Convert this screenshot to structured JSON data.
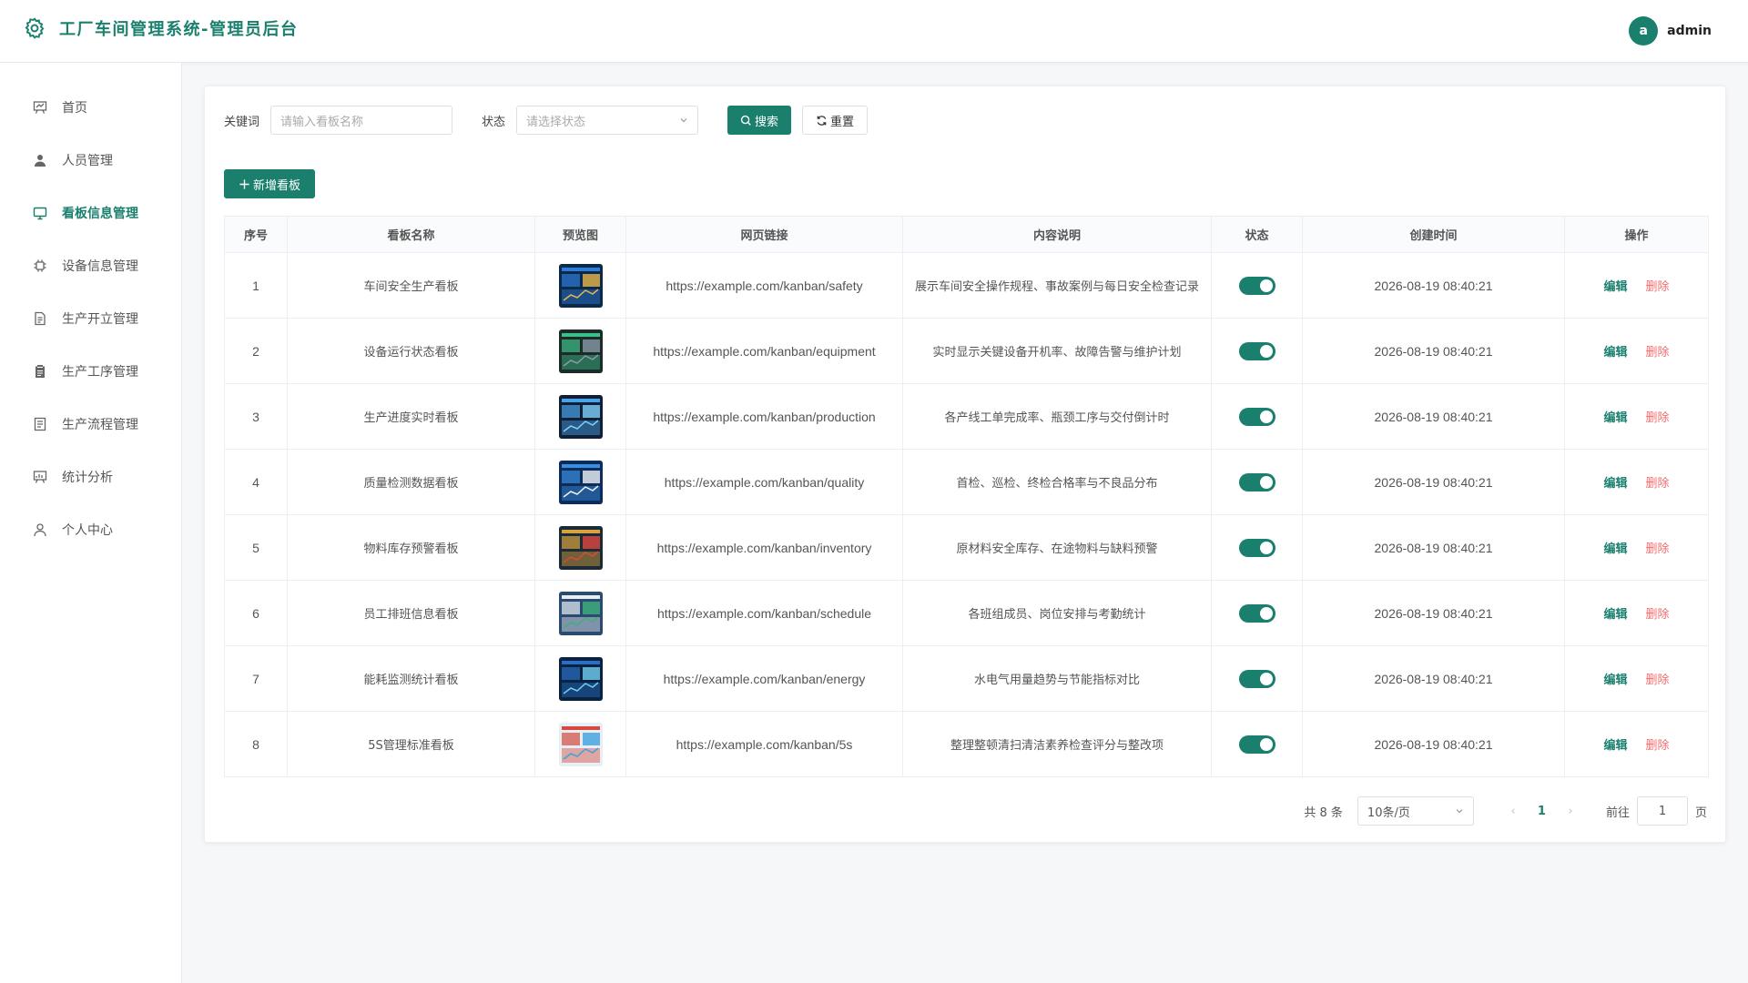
{
  "app": {
    "title": "工厂车间管理系统-管理员后台"
  },
  "user": {
    "avatar_letter": "a",
    "name": "admin"
  },
  "sidebar": {
    "items": [
      {
        "label": "首页",
        "icon": "presentation-board-icon",
        "active": false
      },
      {
        "label": "人员管理",
        "icon": "user-icon",
        "active": false
      },
      {
        "label": "看板信息管理",
        "icon": "monitor-icon",
        "active": true
      },
      {
        "label": "设备信息管理",
        "icon": "chip-icon",
        "active": false
      },
      {
        "label": "生产开立管理",
        "icon": "document-icon",
        "active": false
      },
      {
        "label": "生产工序管理",
        "icon": "clipboard-icon",
        "active": false
      },
      {
        "label": "生产流程管理",
        "icon": "list-document-icon",
        "active": false
      },
      {
        "label": "统计分析",
        "icon": "chart-board-icon",
        "active": false
      },
      {
        "label": "个人中心",
        "icon": "person-outline-icon",
        "active": false
      }
    ]
  },
  "filters": {
    "keyword_label": "关键词",
    "keyword_placeholder": "请输入看板名称",
    "status_label": "状态",
    "status_placeholder": "请选择状态",
    "search_label": "搜索",
    "reset_label": "重置"
  },
  "toolbar": {
    "add_label": "新增看板"
  },
  "table": {
    "columns": [
      "序号",
      "看板名称",
      "预览图",
      "网页链接",
      "内容说明",
      "状态",
      "创建时间",
      "操作"
    ],
    "edit_label": "编辑",
    "delete_label": "删除",
    "rows": [
      {
        "index": "1",
        "name": "车间安全生产看板",
        "url": "https://example.com/kanban/safety",
        "desc": "展示车间安全操作规程、事故案例与每日安全检查记录",
        "enabled": true,
        "created": "2026-08-19 08:40:21"
      },
      {
        "index": "2",
        "name": "设备运行状态看板",
        "url": "https://example.com/kanban/equipment",
        "desc": "实时显示关键设备开机率、故障告警与维护计划",
        "enabled": true,
        "created": "2026-08-19 08:40:21"
      },
      {
        "index": "3",
        "name": "生产进度实时看板",
        "url": "https://example.com/kanban/production",
        "desc": "各产线工单完成率、瓶颈工序与交付倒计时",
        "enabled": true,
        "created": "2026-08-19 08:40:21"
      },
      {
        "index": "4",
        "name": "质量检测数据看板",
        "url": "https://example.com/kanban/quality",
        "desc": "首检、巡检、终检合格率与不良品分布",
        "enabled": true,
        "created": "2026-08-19 08:40:21"
      },
      {
        "index": "5",
        "name": "物料库存预警看板",
        "url": "https://example.com/kanban/inventory",
        "desc": "原材料安全库存、在途物料与缺料预警",
        "enabled": true,
        "created": "2026-08-19 08:40:21"
      },
      {
        "index": "6",
        "name": "员工排班信息看板",
        "url": "https://example.com/kanban/schedule",
        "desc": "各班组成员、岗位安排与考勤统计",
        "enabled": true,
        "created": "2026-08-19 08:40:21"
      },
      {
        "index": "7",
        "name": "能耗监测统计看板",
        "url": "https://example.com/kanban/energy",
        "desc": "水电气用量趋势与节能指标对比",
        "enabled": true,
        "created": "2026-08-19 08:40:21"
      },
      {
        "index": "8",
        "name": "5S管理标准看板",
        "url": "https://example.com/kanban/5s",
        "desc": "整理整顿清扫清洁素养检查评分与整改项",
        "enabled": true,
        "created": "2026-08-19 08:40:21"
      }
    ]
  },
  "pagination": {
    "total_text": "共 8 条",
    "page_size": "10条/页",
    "current_page": "1",
    "goto_label": "前往",
    "goto_value": "1",
    "page_suffix": "页"
  },
  "colors": {
    "primary": "#1a7f6d",
    "danger": "#f56c6c"
  }
}
